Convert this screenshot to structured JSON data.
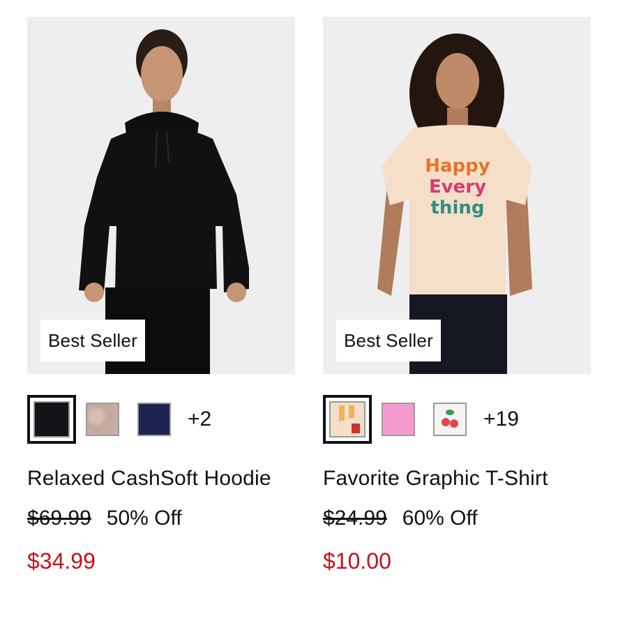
{
  "products": [
    {
      "badge": "Best Seller",
      "name": "Relaxed CashSoft Hoodie",
      "original_price": "$69.99",
      "discount": "50% Off",
      "sale_price": "$34.99",
      "more_colors": "+2",
      "swatches": [
        {
          "name": "black",
          "color": "#121418",
          "selected": true
        },
        {
          "name": "heather-pink",
          "color": "#c9aea6",
          "selected": false
        },
        {
          "name": "navy",
          "color": "#1d2452",
          "selected": false
        }
      ]
    },
    {
      "badge": "Best Seller",
      "name": "Favorite Graphic T-Shirt",
      "original_price": "$24.99",
      "discount": "60% Off",
      "sale_price": "$10.00",
      "more_colors": "+19",
      "swatches": [
        {
          "name": "cream-graphic",
          "color": "#f3dfc8",
          "selected": true
        },
        {
          "name": "pink",
          "color": "#f59bd0",
          "selected": false
        },
        {
          "name": "white-cherry-print",
          "color": "#f4f4f2",
          "selected": false
        }
      ]
    }
  ],
  "colors": {
    "sale_red": "#c2121c",
    "image_bg": "#ededed",
    "text": "#111111"
  }
}
